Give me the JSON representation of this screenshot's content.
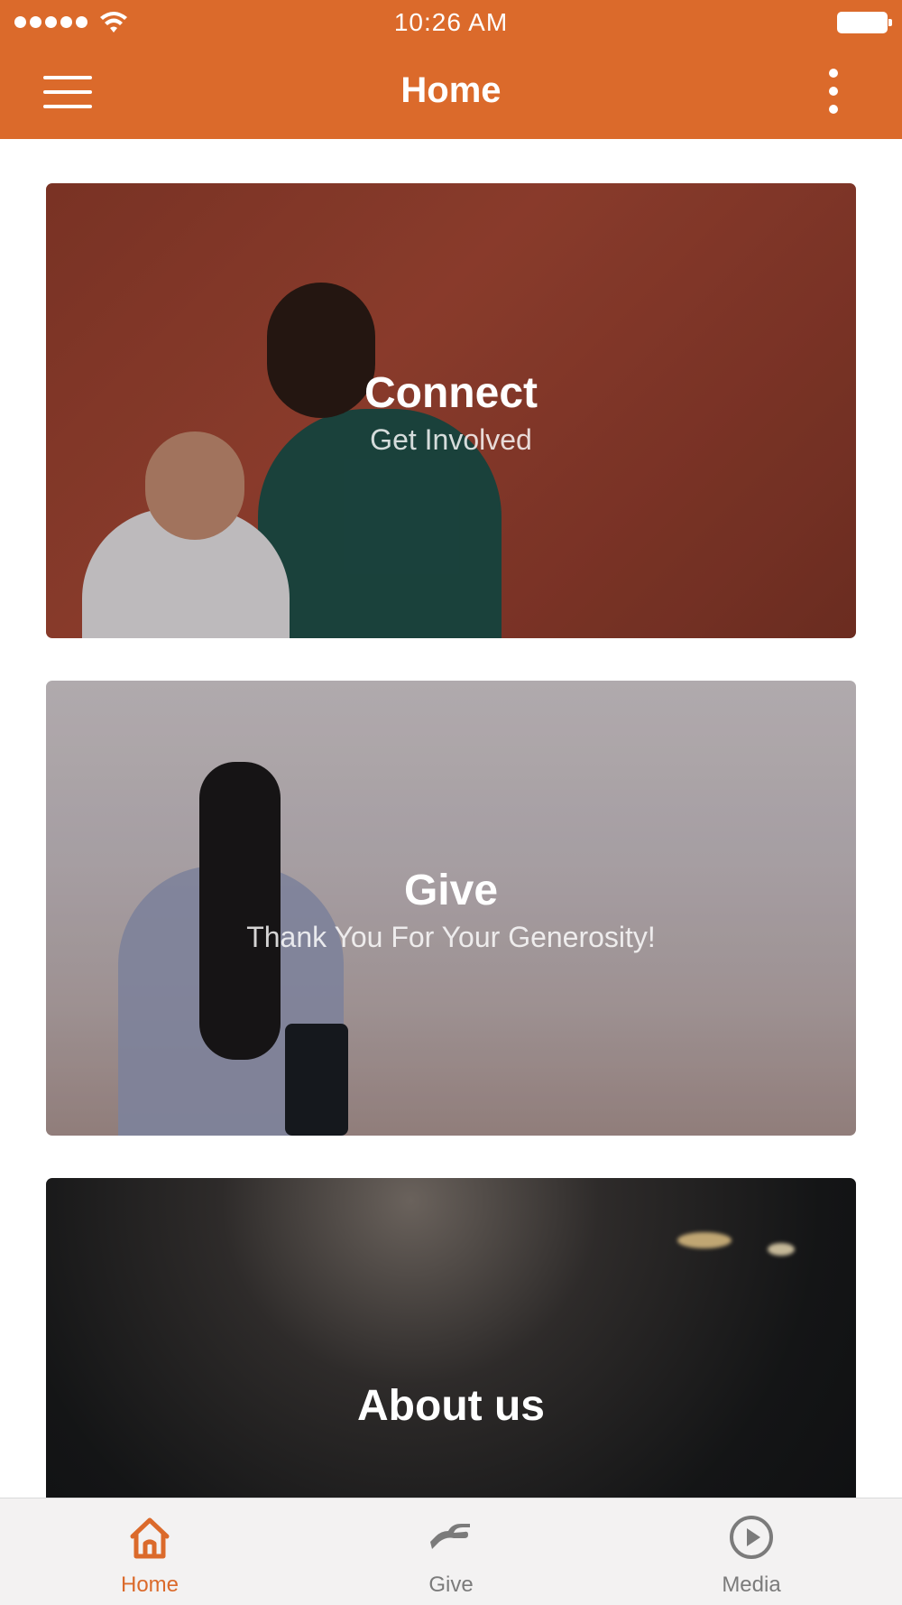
{
  "status_bar": {
    "time": "10:26 AM"
  },
  "header": {
    "title": "Home",
    "background_color": "#DB6A2B",
    "menu_icon": "hamburger-menu-icon",
    "more_icon": "more-vertical-icon"
  },
  "cards": [
    {
      "title": "Connect",
      "subtitle": "Get Involved"
    },
    {
      "title": "Give",
      "subtitle": "Thank You For Your Generosity!"
    },
    {
      "title": "About us"
    }
  ],
  "tabbar": {
    "active_color": "#DB6A2B",
    "inactive_color": "#7b7b7b",
    "tabs": [
      {
        "label": "Home",
        "icon": "home-icon",
        "active": true
      },
      {
        "label": "Give",
        "icon": "give-hand-icon",
        "active": false
      },
      {
        "label": "Media",
        "icon": "play-circle-icon",
        "active": false
      }
    ]
  }
}
